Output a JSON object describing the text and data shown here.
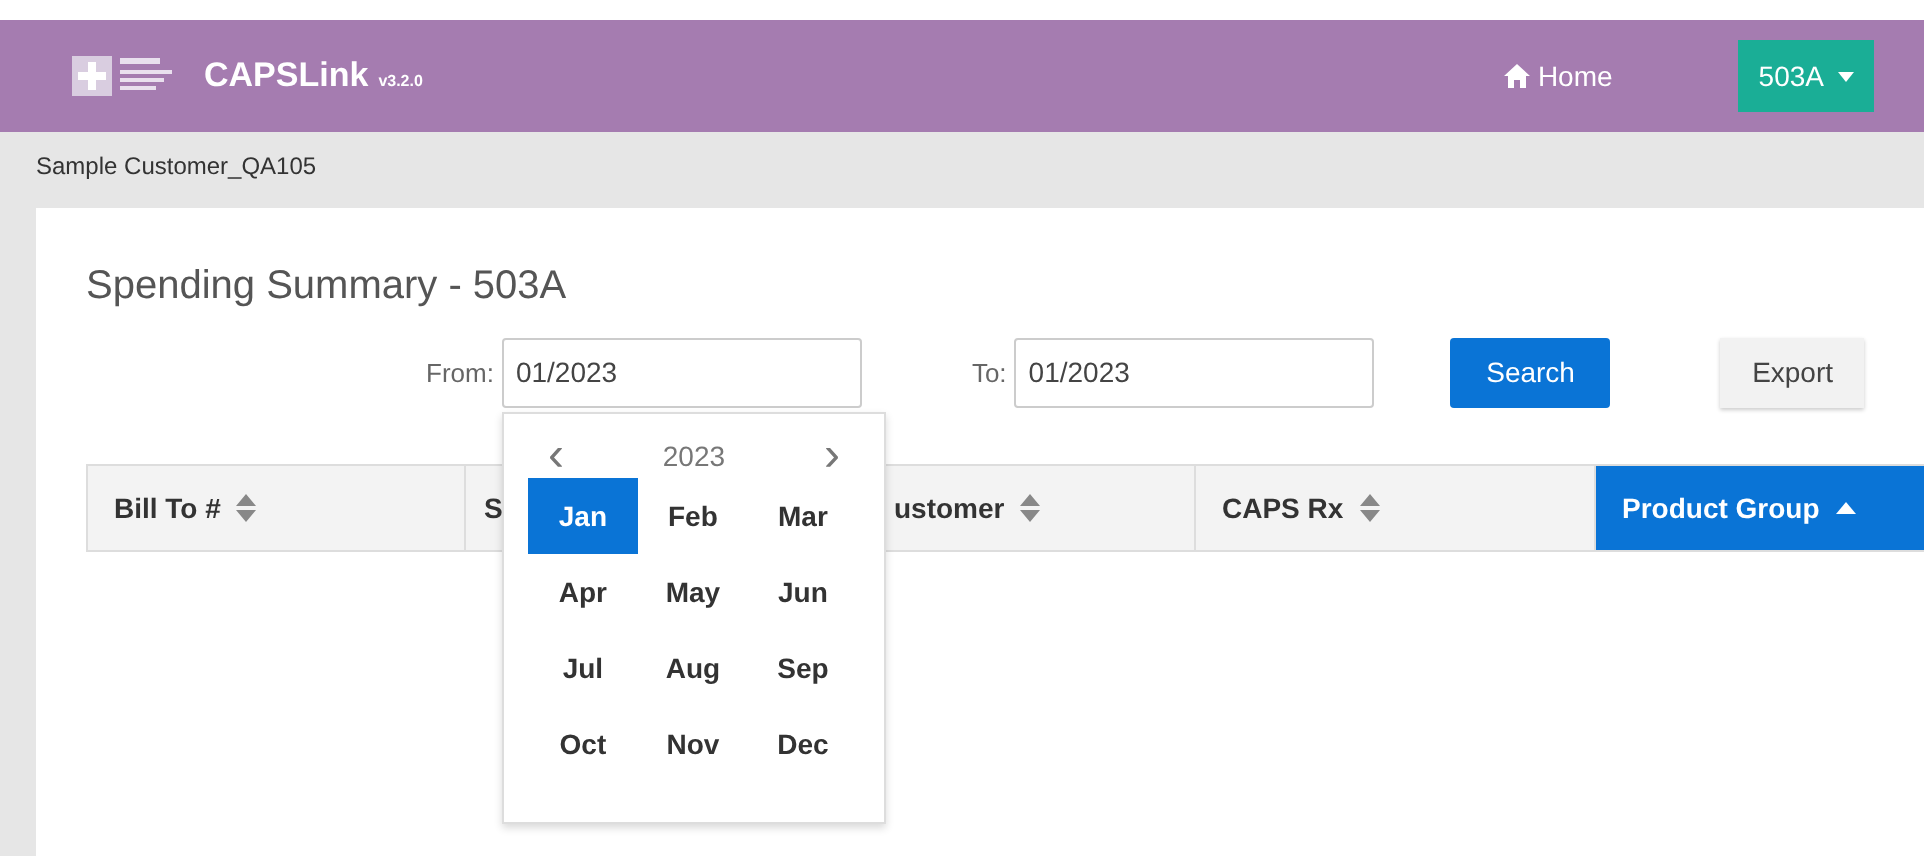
{
  "header": {
    "brand": "CAPSLink",
    "version": "v3.2.0",
    "home": "Home",
    "account": "503A"
  },
  "breadcrumb": "Sample Customer_QA105",
  "page_title": "Spending Summary - 503A",
  "filters": {
    "from_label": "From:",
    "from_value": "01/2023",
    "to_label": "To:",
    "to_value": "01/2023",
    "search": "Search",
    "export": "Export"
  },
  "month_picker": {
    "year": "2023",
    "prev": "‹",
    "next": "›",
    "months": [
      {
        "label": "Jan",
        "selected": true
      },
      {
        "label": "Feb",
        "selected": false
      },
      {
        "label": "Mar",
        "selected": false
      },
      {
        "label": "Apr",
        "selected": false
      },
      {
        "label": "May",
        "selected": false
      },
      {
        "label": "Jun",
        "selected": false
      },
      {
        "label": "Jul",
        "selected": false
      },
      {
        "label": "Aug",
        "selected": false
      },
      {
        "label": "Sep",
        "selected": false
      },
      {
        "label": "Oct",
        "selected": false
      },
      {
        "label": "Nov",
        "selected": false
      },
      {
        "label": "Dec",
        "selected": false
      }
    ]
  },
  "table": {
    "columns": [
      {
        "label": "Bill To #",
        "selected": false,
        "sort_ascending": false
      },
      {
        "label": "S",
        "selected": false
      },
      {
        "label": "ustomer",
        "selected": false,
        "sort_ascending": false
      },
      {
        "label": "CAPS Rx",
        "selected": false,
        "sort_ascending": false
      },
      {
        "label": "Product Group",
        "selected": true,
        "sort_ascending": true
      }
    ]
  }
}
